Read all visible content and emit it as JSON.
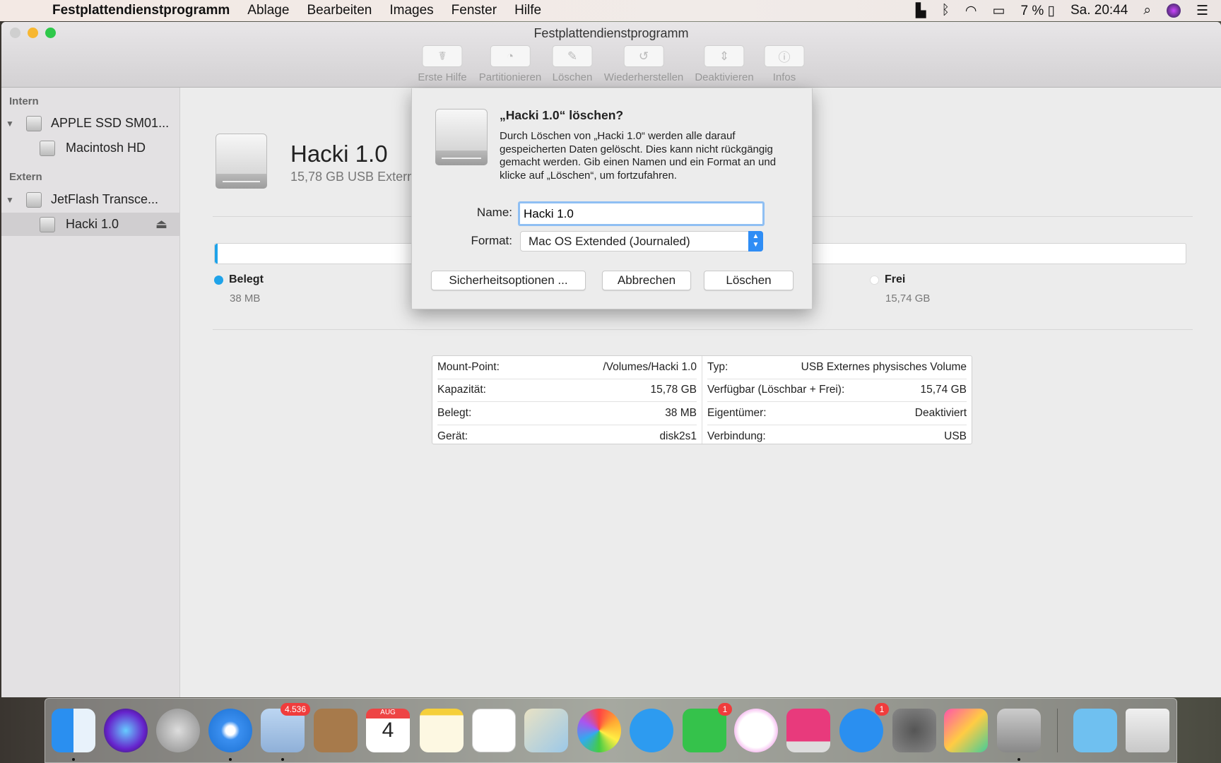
{
  "menubar": {
    "app_name": "Festplattendienstprogramm",
    "items": [
      "Ablage",
      "Bearbeiten",
      "Images",
      "Fenster",
      "Hilfe"
    ],
    "battery": "7 %",
    "clock": "Sa. 20:44"
  },
  "window": {
    "title": "Festplattendienstprogramm",
    "toolbar": [
      {
        "label": "Erste Hilfe",
        "icon": "stethoscope-icon"
      },
      {
        "label": "Partitionieren",
        "icon": "pie-chart-icon"
      },
      {
        "label": "Löschen",
        "icon": "erase-icon"
      },
      {
        "label": "Wiederherstellen",
        "icon": "restore-icon"
      },
      {
        "label": "Deaktivieren",
        "icon": "unmount-icon"
      },
      {
        "label": "Infos",
        "icon": "info-icon"
      }
    ]
  },
  "sidebar": {
    "internal_header": "Intern",
    "external_header": "Extern",
    "items": [
      {
        "label": "APPLE SSD SM01..."
      },
      {
        "label": "Macintosh HD"
      },
      {
        "label": "JetFlash Transce..."
      },
      {
        "label": "Hacki 1.0",
        "selected": true
      }
    ]
  },
  "volume": {
    "name": "Hacki 1.0",
    "subtitle": "15,78 GB USB Externes physisches Volume",
    "used_fraction": 0.0024,
    "legend": [
      {
        "label": "Belegt",
        "value": "38 MB",
        "color": "#1fa3e9"
      },
      {
        "label": "Frei",
        "value": "15,74 GB",
        "color": "#ffffff"
      }
    ],
    "info_left": [
      {
        "key": "Mount-Point:",
        "value": "/Volumes/Hacki 1.0"
      },
      {
        "key": "Kapazität:",
        "value": "15,78 GB"
      },
      {
        "key": "Belegt:",
        "value": "38 MB"
      },
      {
        "key": "Gerät:",
        "value": "disk2s1"
      }
    ],
    "info_right": [
      {
        "key": "Typ:",
        "value": "USB Externes physisches Volume"
      },
      {
        "key": "Verfügbar (Löschbar + Frei):",
        "value": "15,74 GB"
      },
      {
        "key": "Eigentümer:",
        "value": "Deaktiviert"
      },
      {
        "key": "Verbindung:",
        "value": "USB"
      }
    ]
  },
  "dialog": {
    "title": "„Hacki 1.0“ löschen?",
    "body": "Durch Löschen von „Hacki 1.0“ werden alle darauf gespeicherten Daten gelöscht. Dies kann nicht rückgängig gemacht werden. Gib einen Namen und ein Format an und klicke auf „Löschen“, um fortzufahren.",
    "name_label": "Name:",
    "name_value": "Hacki 1.0",
    "format_label": "Format:",
    "format_value": "Mac OS Extended (Journaled)",
    "security_button": "Sicherheitsoptionen ...",
    "cancel_button": "Abbrechen",
    "erase_button": "Löschen"
  },
  "dock": {
    "badges": {
      "mail": "4.536",
      "facetime": "1",
      "appstore": "1"
    },
    "calendar_month": "AUG",
    "calendar_day": "4"
  }
}
